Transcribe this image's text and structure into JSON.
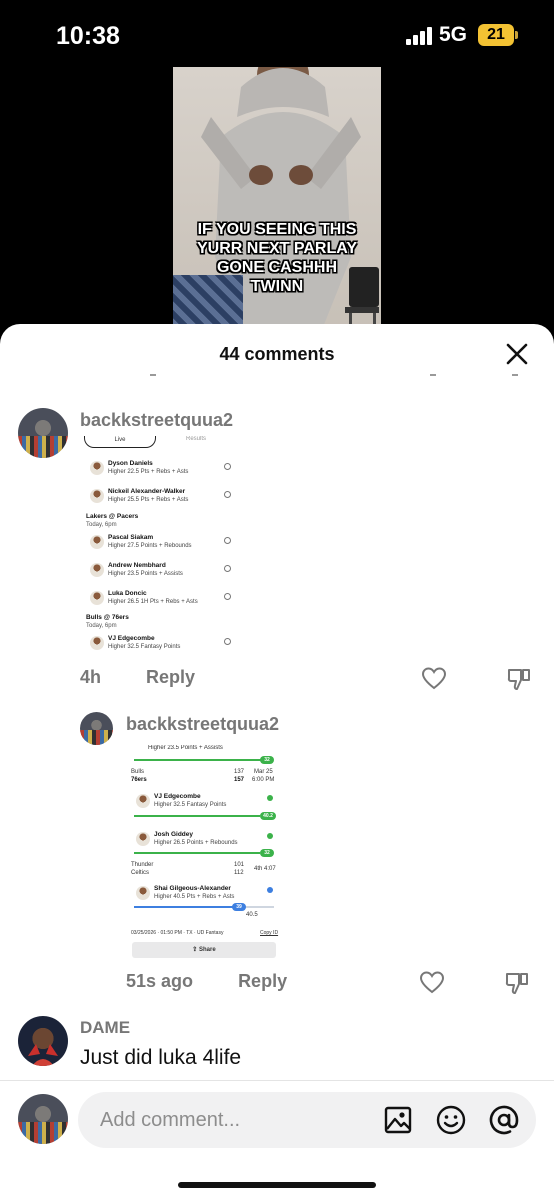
{
  "status_bar": {
    "time": "10:38",
    "network": "5G",
    "battery": "21"
  },
  "video": {
    "caption": "IF YOU SEEING THIS\nYURR NEXT PARLAY\nGONE CASHHH\nTWINN"
  },
  "sheet": {
    "title": "44 comments"
  },
  "comments": [
    {
      "username": "backkstreetquua2",
      "time": "4h",
      "reply_label": "Reply",
      "image": {
        "tab_live": "Live",
        "tab_results": "Results",
        "picks": [
          {
            "name": "Dyson Daniels",
            "line": "Higher 22.5 Pts + Rebs + Asts"
          },
          {
            "name": "Nickeil Alexander-Walker",
            "line": "Higher 25.5 Pts + Rebs + Asts"
          },
          {
            "name": "Pascal Siakam",
            "line": "Higher 27.5 Points + Rebounds"
          },
          {
            "name": "Andrew Nembhard",
            "line": "Higher 23.5 Points + Assists"
          },
          {
            "name": "Luka Doncic",
            "line": "Higher 26.5 1H Pts + Rebs + Asts"
          },
          {
            "name": "VJ Edgecombe",
            "line": "Higher 32.5 Fantasy Points"
          }
        ],
        "games": [
          {
            "matchup": "Lakers @ Pacers",
            "when": "Today, 6pm"
          },
          {
            "matchup": "Bulls @ 76ers",
            "when": "Today, 6pm"
          }
        ]
      }
    },
    {
      "username": "backkstreetquua2",
      "time": "51s ago",
      "reply_label": "Reply",
      "image": {
        "top_line": "Higher 23.5 Points + Assists",
        "top_badge": "32",
        "game1": {
          "team1": "Bulls",
          "team2": "76ers",
          "score1": "137",
          "score2": "157",
          "date": "Mar 25",
          "time": "6:00 PM"
        },
        "pick1": {
          "name": "VJ Edgecombe",
          "line": "Higher 32.5 Fantasy Points",
          "badge": "40.2"
        },
        "pick2": {
          "name": "Josh Giddey",
          "line": "Higher 26.5 Points + Rebounds",
          "badge": "32"
        },
        "game2": {
          "team1": "Thunder",
          "team2": "Celtics",
          "score1": "101",
          "score2": "112",
          "status": "4th 4:07"
        },
        "pick3": {
          "name": "Shai Gilgeous-Alexander",
          "line": "Higher 40.5 Pts + Rebs + Asts",
          "badge": "39",
          "target": "40.5"
        },
        "footer": "03/25/2026 · 01:50 PM · TX · UD Fantasy",
        "copy_id": "Copy ID",
        "share": "Share"
      }
    },
    {
      "username": "DAME",
      "text": "Just did luka 4life"
    }
  ],
  "input": {
    "placeholder": "Add comment..."
  },
  "colors": {
    "accent_green": "#3bb24a",
    "battery": "#f3c233"
  }
}
